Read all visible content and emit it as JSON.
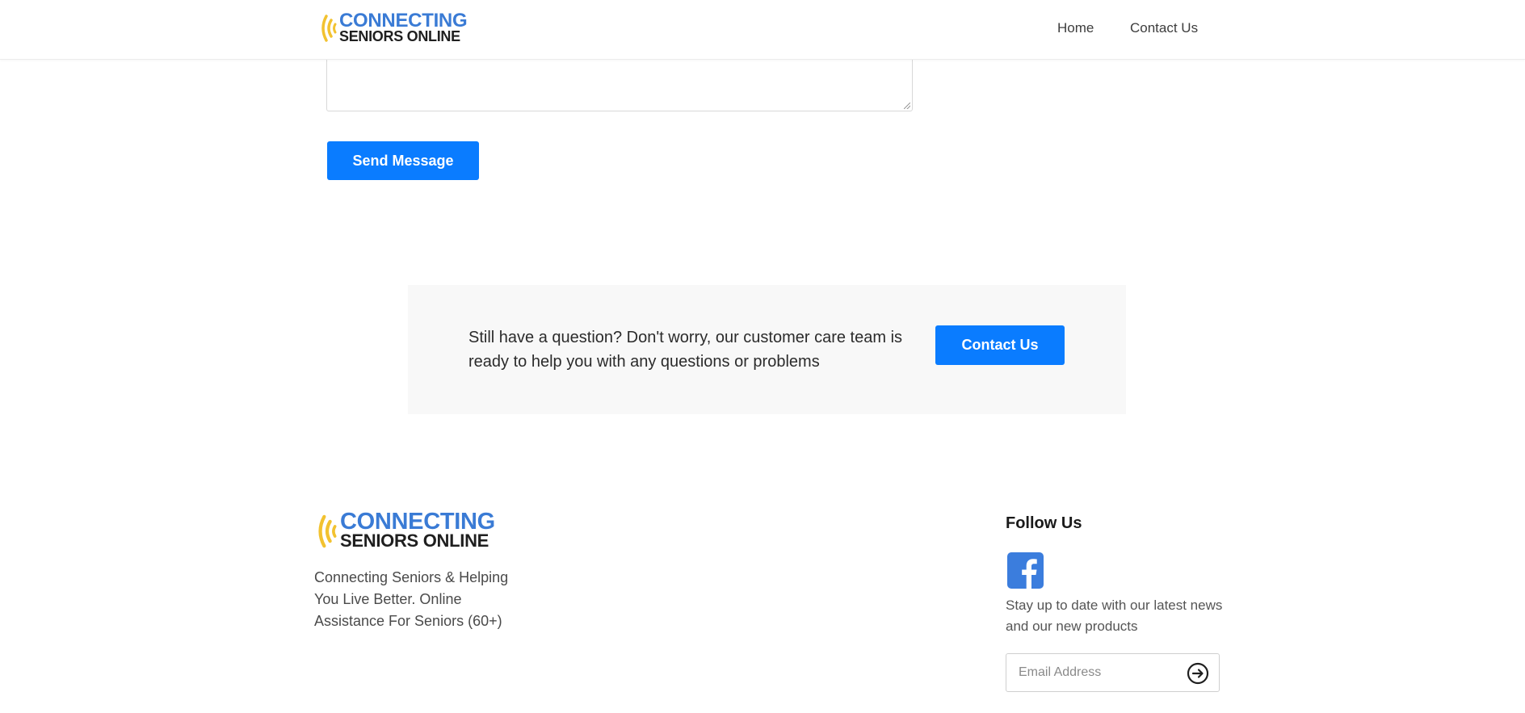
{
  "header": {
    "logo": {
      "line1": "CONNECTING",
      "line2": "SENIORS ONLINE"
    },
    "nav": [
      {
        "label": "Home"
      },
      {
        "label": "Contact Us"
      }
    ]
  },
  "form": {
    "send_button": "Send Message"
  },
  "cta": {
    "text": "Still have a question? Don't worry, our customer care team is ready to help you with any questions or problems",
    "button": "Contact Us"
  },
  "footer": {
    "logo": {
      "line1": "CONNECTING",
      "line2": "SENIORS ONLINE"
    },
    "tagline": "Connecting Seniors & Helping You Live Better. Online Assistance For Seniors (60+)",
    "follow_title": "Follow Us",
    "social_icon": "facebook-icon",
    "newsletter_text": "Stay up to date with our latest news and our new products",
    "email_placeholder": "Email Address",
    "submit_icon": "arrow-right-circle-icon"
  },
  "colors": {
    "brand_blue": "#3a7bd5",
    "button_blue": "#0a7cff",
    "logo_waves": "#f2c230",
    "cta_background": "#f8f8f8",
    "facebook": "#3b7ddd"
  }
}
